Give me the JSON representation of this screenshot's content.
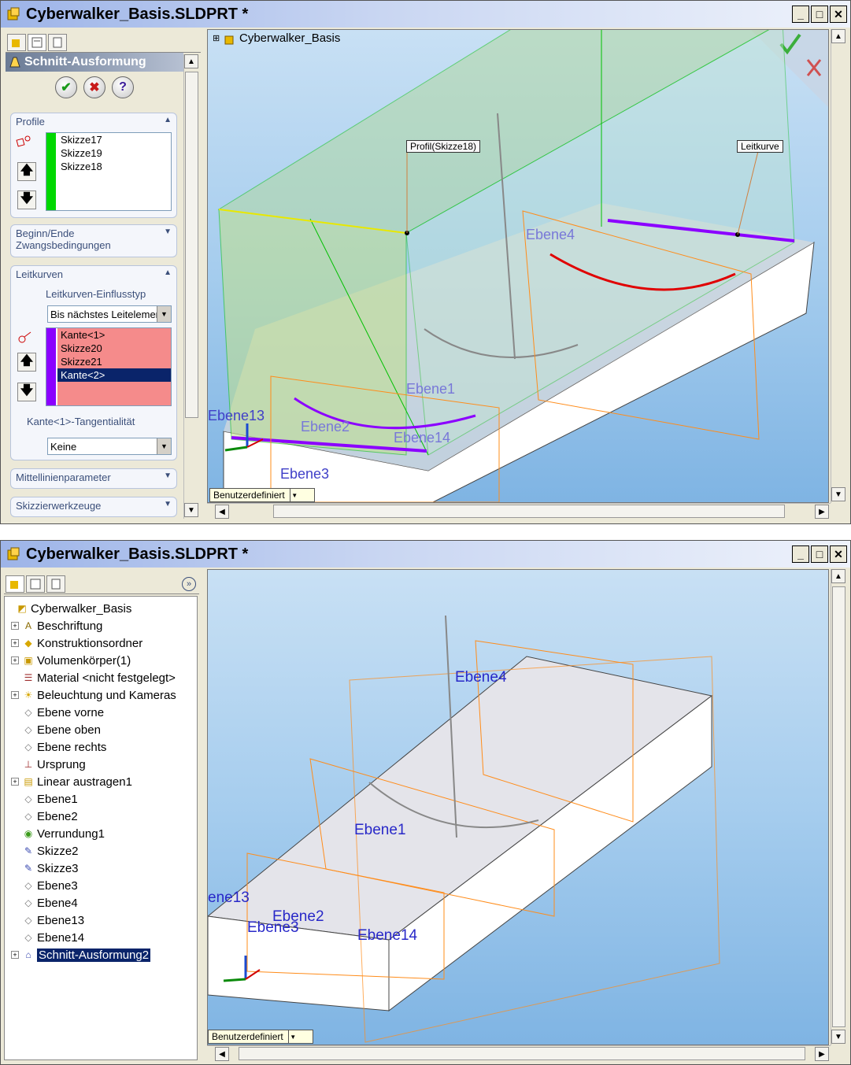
{
  "top_window": {
    "title": "Cyberwalker_Basis.SLDPRT *",
    "feature_tree_root": "Cyberwalker_Basis",
    "property_manager": {
      "title": "Schnitt-Ausformung",
      "profile_group": {
        "title": "Profile",
        "items": [
          "Skizze17",
          "Skizze19",
          "Skizze18"
        ]
      },
      "start_end_group": {
        "title": "Beginn/Ende Zwangsbedingungen"
      },
      "guide_group": {
        "title": "Leitkurven",
        "influence_label": "Leitkurven-Einflusstyp",
        "influence_value": "Bis nächstes Leitelement",
        "items": [
          "Kante<1>",
          "Skizze20",
          "Skizze21",
          "Kante<2>"
        ],
        "selected_index": 3,
        "tangency_label": "Kante<1>-Tangentialität",
        "tangency_value": "Keine"
      },
      "centerline_group": {
        "title": "Mittellinienparameter"
      },
      "sketch_tools_group": {
        "title": "Skizzierwerkzeuge"
      }
    },
    "viewport": {
      "callouts": [
        "Profil(Skizze18)",
        "Leitkurve"
      ],
      "plane_labels": [
        "Ebene4",
        "Ebene1",
        "Ebene13",
        "Ebene2",
        "Ebene14",
        "Ebene3"
      ],
      "view_selector": "Benutzerdefiniert"
    }
  },
  "bottom_window": {
    "title": "Cyberwalker_Basis.SLDPRT *",
    "tree": [
      {
        "label": "Cyberwalker_Basis",
        "icon": "part-icon",
        "expander": false,
        "root": true
      },
      {
        "label": "Beschriftung",
        "icon": "annotation-icon",
        "expander": true
      },
      {
        "label": "Konstruktionsordner",
        "icon": "folder-icon",
        "expander": true
      },
      {
        "label": "Volumenkörper(1)",
        "icon": "solid-body-icon",
        "expander": true
      },
      {
        "label": "Material <nicht festgelegt>",
        "icon": "material-icon",
        "expander": false
      },
      {
        "label": "Beleuchtung und Kameras",
        "icon": "lighting-icon",
        "expander": true
      },
      {
        "label": "Ebene vorne",
        "icon": "plane-icon",
        "expander": false
      },
      {
        "label": "Ebene oben",
        "icon": "plane-icon",
        "expander": false
      },
      {
        "label": "Ebene rechts",
        "icon": "plane-icon",
        "expander": false
      },
      {
        "label": "Ursprung",
        "icon": "origin-icon",
        "expander": false
      },
      {
        "label": "Linear austragen1",
        "icon": "extrude-icon",
        "expander": true
      },
      {
        "label": "Ebene1",
        "icon": "plane-icon",
        "expander": false
      },
      {
        "label": "Ebene2",
        "icon": "plane-icon",
        "expander": false
      },
      {
        "label": "Verrundung1",
        "icon": "fillet-icon",
        "expander": false
      },
      {
        "label": "Skizze2",
        "icon": "sketch-icon",
        "expander": false
      },
      {
        "label": "Skizze3",
        "icon": "sketch-icon",
        "expander": false
      },
      {
        "label": "Ebene3",
        "icon": "plane-icon",
        "expander": false
      },
      {
        "label": "Ebene4",
        "icon": "plane-icon",
        "expander": false
      },
      {
        "label": "Ebene13",
        "icon": "plane-icon",
        "expander": false
      },
      {
        "label": "Ebene14",
        "icon": "plane-icon",
        "expander": false
      },
      {
        "label": "Schnitt-Ausformung2",
        "icon": "loft-icon",
        "expander": true,
        "selected": true
      }
    ],
    "viewport": {
      "plane_labels": [
        "Ebene4",
        "Ebene1",
        "ene13",
        "Ebene2",
        "Ebene3",
        "Ebene14"
      ],
      "view_selector": "Benutzerdefiniert"
    }
  },
  "colors": {
    "profile_bar": "#00d800",
    "guide_bar": "#8b00ff",
    "guide_list_bg": "#f58b8b",
    "selection": "#0a246a"
  }
}
